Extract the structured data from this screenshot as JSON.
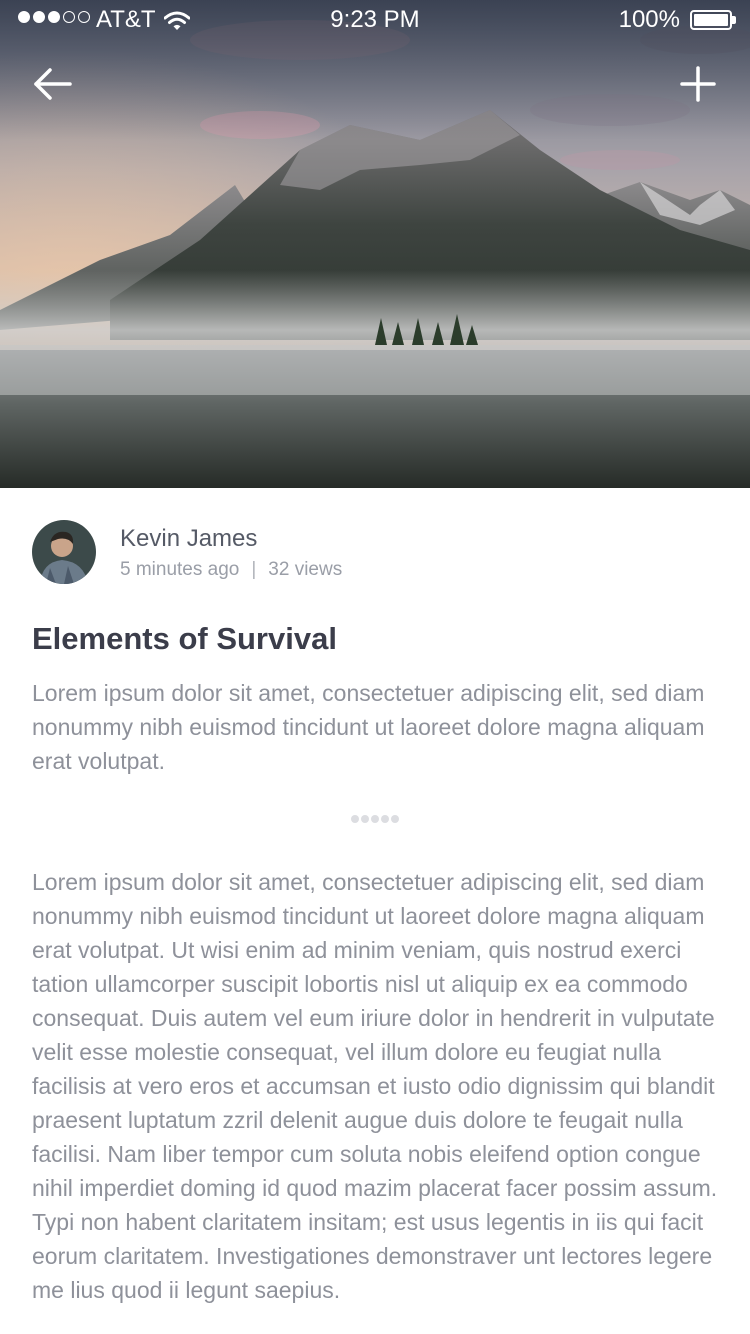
{
  "status_bar": {
    "carrier": "AT&T",
    "time": "9:23 PM",
    "battery": "100%",
    "signal_bars_filled": 3,
    "signal_bars_total": 5
  },
  "nav": {
    "back_icon": "arrow-left-icon",
    "add_icon": "plus-icon"
  },
  "hero": {
    "icon": "mountain-lake-photo"
  },
  "author": {
    "name": "Kevin James",
    "time_ago": "5 minutes ago",
    "separator": "|",
    "views": "32 views"
  },
  "article": {
    "title": "Elements of Survival",
    "intro": "Lorem ipsum dolor sit amet, consectetuer adipiscing elit, sed diam nonummy nibh euismod tincidunt ut laoreet dolore magna aliquam erat volutpat.",
    "body": "Lorem ipsum dolor sit amet, consectetuer adipiscing elit, sed diam nonummy nibh euismod tincidunt ut laoreet dolore magna aliquam erat volutpat. Ut wisi enim ad minim veniam, quis nostrud exerci tation ullamcorper suscipit lobortis nisl ut aliquip ex ea commodo consequat. Duis autem vel eum iriure dolor in hendrerit in vulputate velit esse molestie consequat, vel illum dolore eu feugiat nulla facilisis at vero eros et accumsan et iusto odio dignissim qui blandit praesent luptatum zzril delenit augue duis dolore te feugait nulla facilisi. Nam liber tempor cum soluta nobis eleifend option congue nihil imperdiet doming id quod mazim placerat facer possim assum. Typi non habent claritatem insitam; est usus legentis in iis qui facit eorum claritatem. Investigationes demonstraver unt lectores legere me lius quod ii legunt saepius."
  },
  "colors": {
    "title": "#3b3d4a",
    "text": "#8e919a",
    "meta": "#9a9ea7",
    "name": "#555a66",
    "divider_dots": "#dcdde1"
  }
}
